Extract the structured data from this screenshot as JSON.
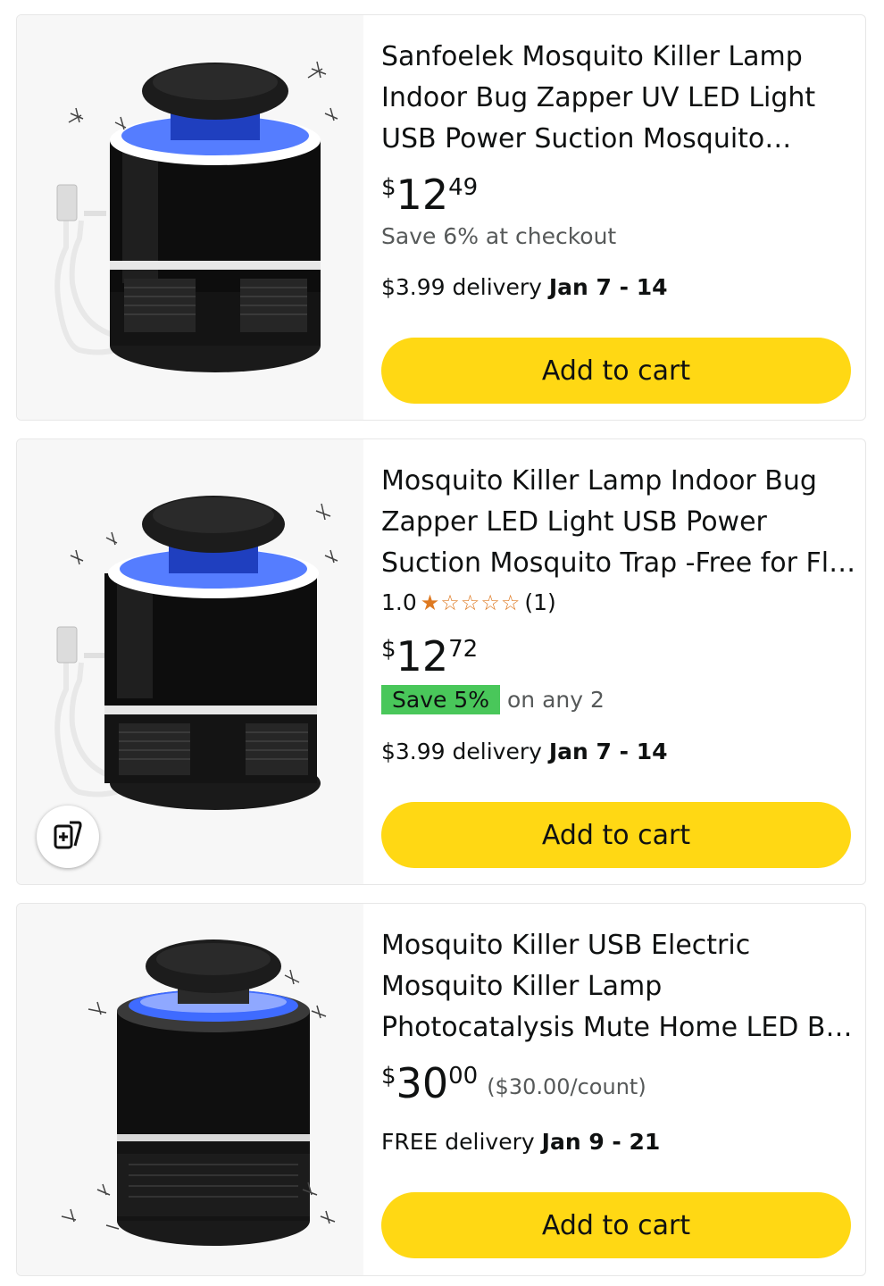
{
  "products": [
    {
      "title": "Sanfoelek Mosquito Killer Lamp Indoor Bug Zapper UV LED Light USB Power Suction Mosquito…",
      "price_symbol": "$",
      "price_whole": "12",
      "price_fraction": "49",
      "promo": "Save 6% at checkout",
      "delivery_prefix": "$3.99 delivery",
      "delivery_date": "Jan 7 - 14",
      "button_label": "Add to cart"
    },
    {
      "title": "Mosquito Killer Lamp Indoor Bug Zapper LED Light USB Power Suction Mosquito Trap -Free for Fl…",
      "rating_value": "1.0",
      "rating_stars": 1,
      "rating_count": "(1)",
      "price_symbol": "$",
      "price_whole": "12",
      "price_fraction": "72",
      "save_badge": "Save 5%",
      "save_after": "on any 2",
      "delivery_prefix": "$3.99 delivery",
      "delivery_date": "Jan 7 - 14",
      "button_label": "Add to cart",
      "compare_icon": "add-to-compare-icon"
    },
    {
      "title": "Mosquito Killer USB Electric Mosquito Killer Lamp Photocatalysis Mute Home LED B…",
      "price_symbol": "$",
      "price_whole": "30",
      "price_fraction": "00",
      "unit_price": "($30.00/count)",
      "delivery_prefix": "FREE delivery",
      "delivery_date": "Jan 9 - 21",
      "button_label": "Add to cart"
    }
  ],
  "colors": {
    "button": "#ffd814",
    "star": "#de7921",
    "save_badge": "#49c75a",
    "muted_text": "#565959",
    "image_background": "#f7f7f7",
    "lamp_glow": "#2a5cff"
  }
}
